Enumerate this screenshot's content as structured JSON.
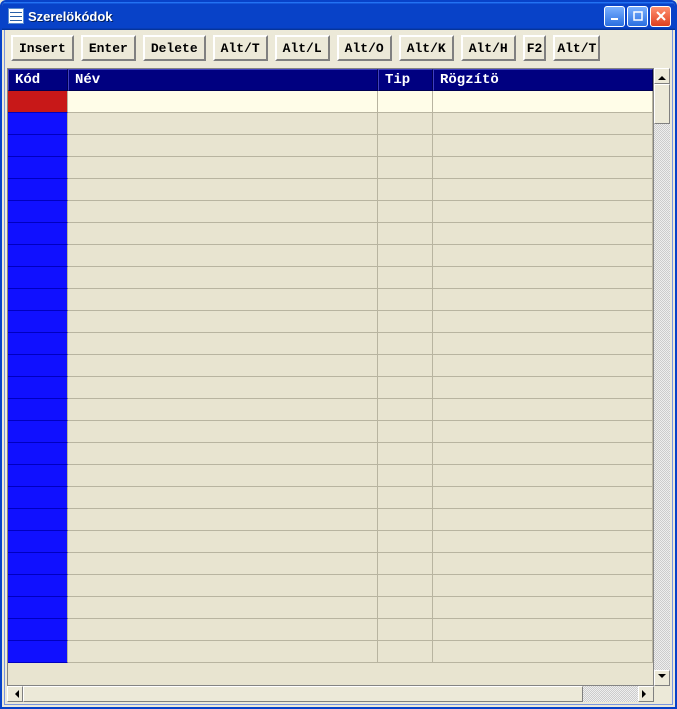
{
  "window": {
    "title": "Szerelökódok"
  },
  "toolbar": {
    "insert": "Insert",
    "enter": "Enter",
    "delete": "Delete",
    "alt_t": "Alt/T",
    "alt_l": "Alt/L",
    "alt_o": "Alt/O",
    "alt_k": "Alt/K",
    "alt_h": "Alt/H",
    "f2": "F2",
    "alt_t2": "Alt/T"
  },
  "columns": {
    "kod": "Kód",
    "nev": "Név",
    "tip": "Tip",
    "rogzito": "Rögzítö"
  },
  "rows": [
    {
      "kod": "",
      "nev": "",
      "tip": "",
      "rogzito": "",
      "selected": true
    },
    {
      "kod": "",
      "nev": "",
      "tip": "",
      "rogzito": ""
    },
    {
      "kod": "",
      "nev": "",
      "tip": "",
      "rogzito": ""
    },
    {
      "kod": "",
      "nev": "",
      "tip": "",
      "rogzito": ""
    },
    {
      "kod": "",
      "nev": "",
      "tip": "",
      "rogzito": ""
    },
    {
      "kod": "",
      "nev": "",
      "tip": "",
      "rogzito": ""
    },
    {
      "kod": "",
      "nev": "",
      "tip": "",
      "rogzito": ""
    },
    {
      "kod": "",
      "nev": "",
      "tip": "",
      "rogzito": ""
    },
    {
      "kod": "",
      "nev": "",
      "tip": "",
      "rogzito": ""
    },
    {
      "kod": "",
      "nev": "",
      "tip": "",
      "rogzito": ""
    },
    {
      "kod": "",
      "nev": "",
      "tip": "",
      "rogzito": ""
    },
    {
      "kod": "",
      "nev": "",
      "tip": "",
      "rogzito": ""
    },
    {
      "kod": "",
      "nev": "",
      "tip": "",
      "rogzito": ""
    },
    {
      "kod": "",
      "nev": "",
      "tip": "",
      "rogzito": ""
    },
    {
      "kod": "",
      "nev": "",
      "tip": "",
      "rogzito": ""
    },
    {
      "kod": "",
      "nev": "",
      "tip": "",
      "rogzito": ""
    },
    {
      "kod": "",
      "nev": "",
      "tip": "",
      "rogzito": ""
    },
    {
      "kod": "",
      "nev": "",
      "tip": "",
      "rogzito": ""
    },
    {
      "kod": "",
      "nev": "",
      "tip": "",
      "rogzito": ""
    },
    {
      "kod": "",
      "nev": "",
      "tip": "",
      "rogzito": ""
    },
    {
      "kod": "",
      "nev": "",
      "tip": "",
      "rogzito": ""
    },
    {
      "kod": "",
      "nev": "",
      "tip": "",
      "rogzito": ""
    },
    {
      "kod": "",
      "nev": "",
      "tip": "",
      "rogzito": ""
    },
    {
      "kod": "",
      "nev": "",
      "tip": "",
      "rogzito": ""
    },
    {
      "kod": "",
      "nev": "",
      "tip": "",
      "rogzito": ""
    },
    {
      "kod": "",
      "nev": "",
      "tip": "",
      "rogzito": ""
    }
  ]
}
